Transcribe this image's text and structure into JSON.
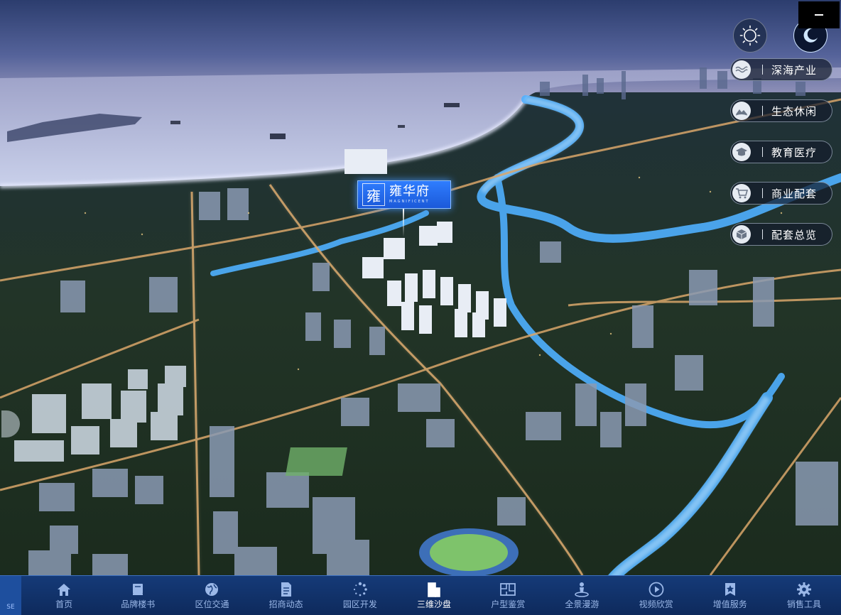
{
  "project": {
    "logo_char": "雍",
    "name": "雍华府",
    "subtitle": "MAGNIFICENT"
  },
  "top_controls": {
    "day_icon": "sun-icon",
    "night_icon": "moon-icon",
    "active": "night"
  },
  "poi_menu": [
    {
      "label": "深海产业",
      "icon": "waves-icon"
    },
    {
      "label": "生态休闲",
      "icon": "landscape-icon"
    },
    {
      "label": "教育医疗",
      "icon": "graduation-cap-icon"
    },
    {
      "label": "商业配套",
      "icon": "cart-icon"
    },
    {
      "label": "配套总览",
      "icon": "cube-icon"
    }
  ],
  "nav": {
    "left_tab": "SE",
    "items": [
      {
        "label": "首页",
        "icon": "home-icon"
      },
      {
        "label": "品牌楼书",
        "icon": "book-icon"
      },
      {
        "label": "区位交通",
        "icon": "globe-icon"
      },
      {
        "label": "招商动态",
        "icon": "document-icon"
      },
      {
        "label": "园区开发",
        "icon": "spinner-icon"
      },
      {
        "label": "三维沙盘",
        "icon": "buildings-icon"
      },
      {
        "label": "户型鉴赏",
        "icon": "floorplan-icon"
      },
      {
        "label": "全景漫游",
        "icon": "person-pin-icon"
      },
      {
        "label": "视频欣赏",
        "icon": "play-icon"
      },
      {
        "label": "增值服务",
        "icon": "badge-icon"
      },
      {
        "label": "销售工具",
        "icon": "gear-icon"
      }
    ],
    "active_index": 5
  }
}
